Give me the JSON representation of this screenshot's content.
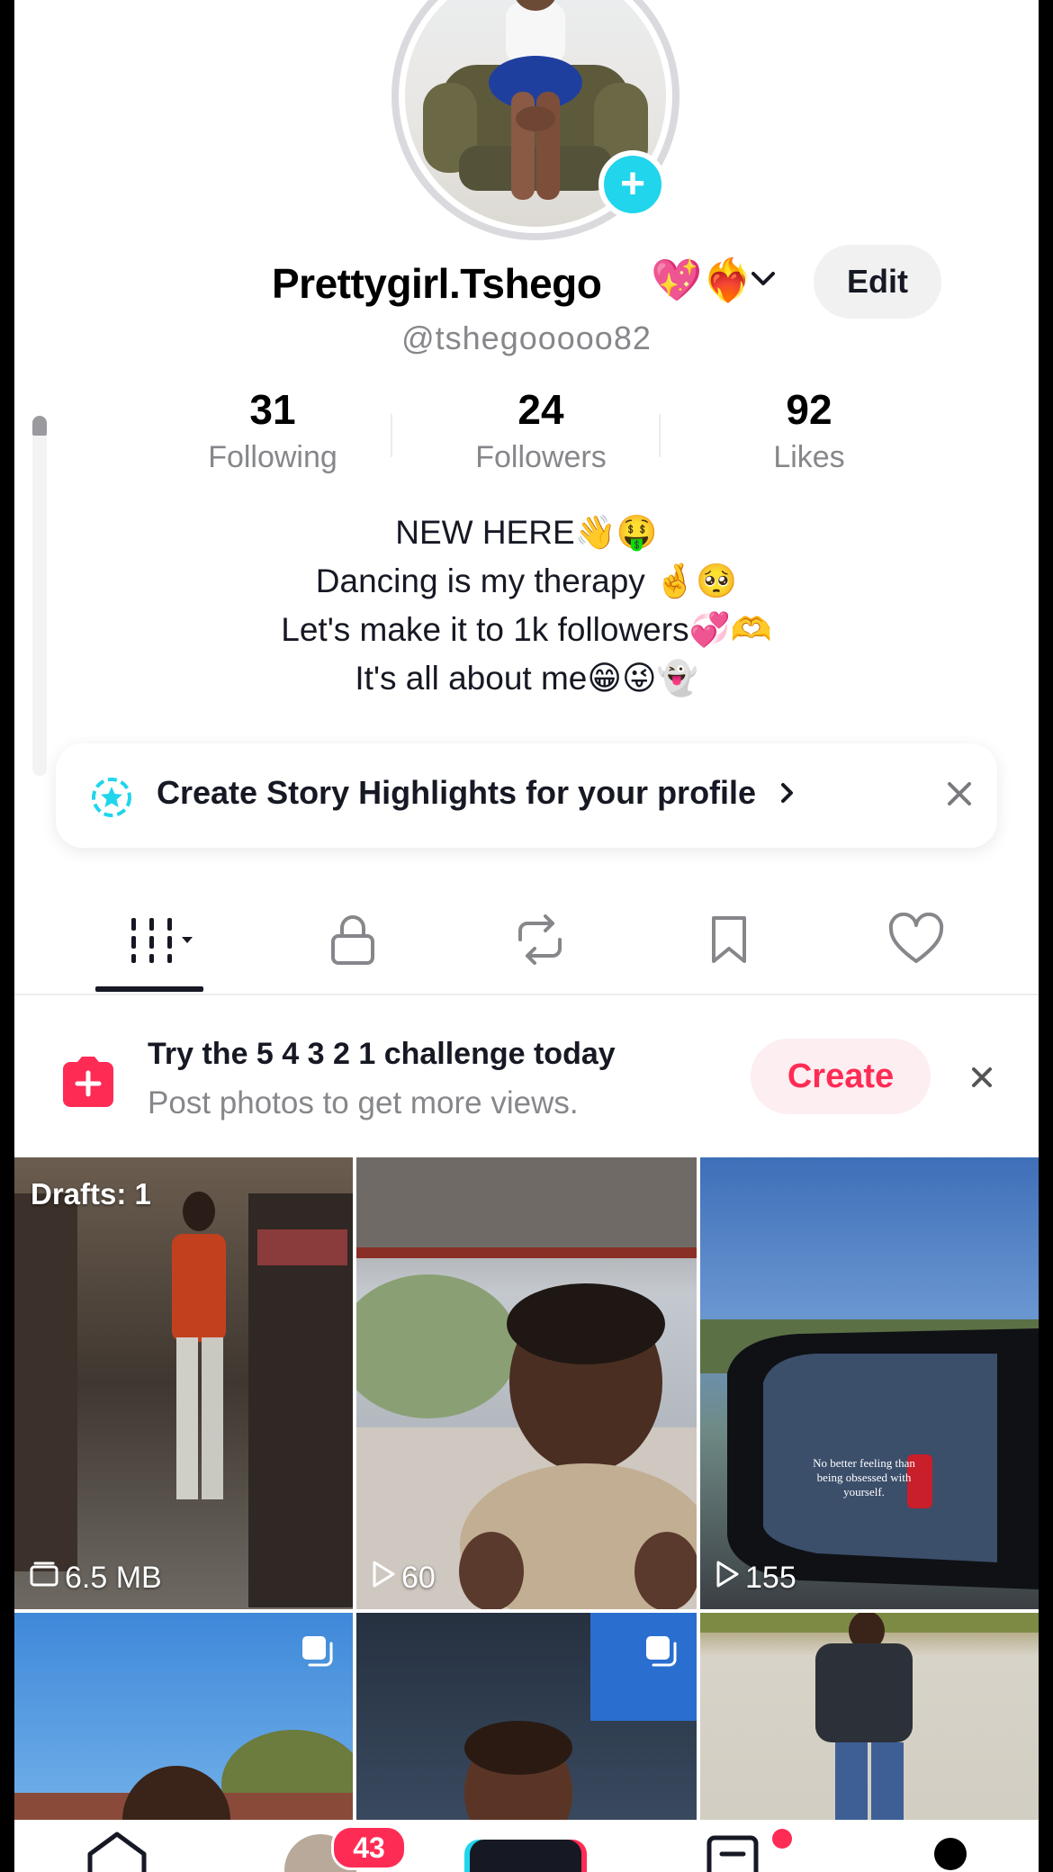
{
  "profile": {
    "display_name": "Prettygirl.Tshego",
    "name_emojis": "💖❤️‍🔥",
    "handle": "@tshegooooo82",
    "edit_label": "Edit"
  },
  "stats": [
    {
      "value": "31",
      "label": "Following"
    },
    {
      "value": "24",
      "label": "Followers"
    },
    {
      "value": "92",
      "label": "Likes"
    }
  ],
  "bio": [
    "NEW HERE👋🤑",
    "Dancing is my therapy 🤞🥺",
    "Let's make it to 1k followers💞🫶",
    "It's all about me😁😜👻"
  ],
  "highlights_banner": {
    "text": "Create Story Highlights for your profile",
    "chevron": "›"
  },
  "tabs": [
    "grid-icon",
    "lock-icon",
    "repost-icon",
    "bookmark-icon",
    "heart-icon"
  ],
  "challenge": {
    "title": "Try the 5 4 3 2 1 challenge today",
    "subtitle": "Post photos to get more views.",
    "create_label": "Create"
  },
  "videos": [
    {
      "overlay": "6.5 MB",
      "drafts": "Drafts: 1"
    },
    {
      "overlay": "60"
    },
    {
      "overlay": "155",
      "caption": "No better feeling than being obsessed with yourself."
    }
  ],
  "bottom_nav": {
    "inbox_badge": "43"
  },
  "colors": {
    "accent_red": "#fe2c55",
    "accent_cyan": "#20d5ec",
    "text_primary": "#161823",
    "text_secondary": "#86878b"
  }
}
